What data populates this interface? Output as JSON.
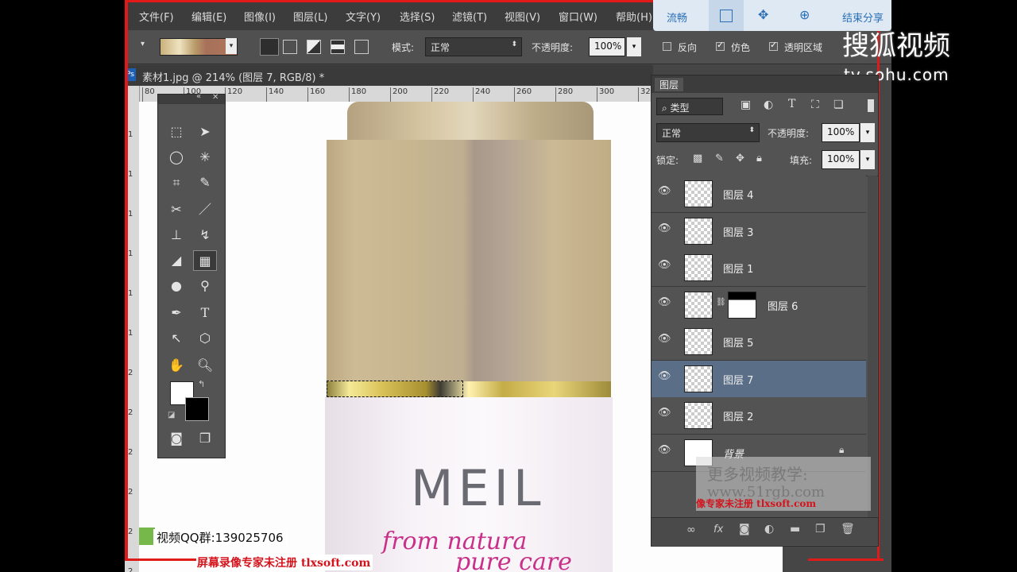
{
  "menu": [
    "文件(F)",
    "编辑(E)",
    "图像(I)",
    "图层(L)",
    "文字(Y)",
    "选择(S)",
    "滤镜(T)",
    "视图(V)",
    "窗口(W)",
    "帮助(H)"
  ],
  "overlay_toolbar": {
    "items": [
      "流畅",
      "结束分享"
    ]
  },
  "watermark": {
    "brand": "搜狐视频",
    "url": "tv.sohu.com"
  },
  "options": {
    "mode_label": "模式:",
    "mode_value": "正常",
    "opacity_label": "不透明度:",
    "opacity_value": "100%",
    "reverse": "反向",
    "dither": "仿色",
    "transparency": "透明区域"
  },
  "document_tab": "素材1.jpg @ 214% (图层 7, RGB/8) *",
  "ruler_ticks": [
    "80",
    "100",
    "120",
    "140",
    "160",
    "180",
    "200",
    "220",
    "240",
    "260",
    "280",
    "300",
    "320",
    "340"
  ],
  "ruler_v_ticks": [
    "1",
    "1",
    "1",
    "1",
    "1",
    "1",
    "2",
    "2",
    "2",
    "2",
    "2",
    "2"
  ],
  "layers_panel": {
    "tab": "图层",
    "filter_kind": "类型",
    "blend_mode": "正常",
    "opacity_label": "不透明度:",
    "opacity_value": "100%",
    "lock_label": "锁定:",
    "fill_label": "填充:",
    "fill_value": "100%",
    "layers": [
      {
        "name": "图层 4",
        "selected": false
      },
      {
        "name": "图层 3",
        "selected": false
      },
      {
        "name": "图层 1",
        "selected": false
      },
      {
        "name": "图层 6",
        "selected": false,
        "has_mask": true
      },
      {
        "name": "图层 5",
        "selected": false
      },
      {
        "name": "图层 7",
        "selected": true
      },
      {
        "name": "图层 2",
        "selected": false
      },
      {
        "name": "背景",
        "selected": false,
        "locked": true
      }
    ]
  },
  "product": {
    "brand": "MEIL",
    "line1": "from natura",
    "line2": "pure care"
  },
  "qq_group": "视频QQ群:139025706",
  "overlay_promo": {
    "line1": "更多视频教学:",
    "line2": "www.51rgb.com",
    "line3": "像专家未注册 tlxsoft.com"
  },
  "recorder_watermark": "屏幕录像专家未注册 tlxsoft.com",
  "colors": {
    "accent_red": "#e01919",
    "selected_layer": "#5a6e88",
    "panel_bg": "#535353"
  }
}
